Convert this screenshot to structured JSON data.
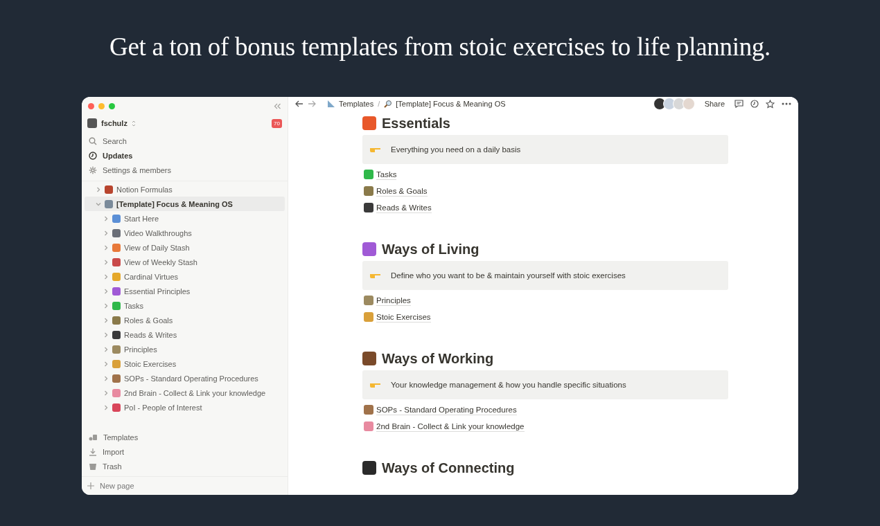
{
  "headline": "Get a ton of bonus templates from stoic exercises to life planning.",
  "sidebar": {
    "workspace": "fschulz",
    "notification_count": "70",
    "nav": [
      {
        "kind": "search",
        "label": "Search",
        "unread": false
      },
      {
        "kind": "updates",
        "label": "Updates",
        "unread": true
      },
      {
        "kind": "settings",
        "label": "Settings & members",
        "unread": false
      }
    ],
    "pages": [
      {
        "label": "Notion Formulas",
        "color": "#b8452e",
        "expanded": false,
        "selected": false
      },
      {
        "label": "[Template] Focus & Meaning OS",
        "color": "#7a8a9a",
        "expanded": true,
        "selected": true,
        "children": [
          {
            "label": "Start Here",
            "color": "#5b8fd6",
            "expanded": false,
            "selected": false
          },
          {
            "label": "Video Walkthroughs",
            "color": "#6b6f78",
            "expanded": false,
            "selected": false
          },
          {
            "label": "View of Daily Stash",
            "color": "#e8793a",
            "expanded": false,
            "selected": false
          },
          {
            "label": "View of Weekly Stash",
            "color": "#c94a4a",
            "expanded": false,
            "selected": false
          },
          {
            "label": "Cardinal Virtues",
            "color": "#e5a82a",
            "expanded": false,
            "selected": false
          },
          {
            "label": "Essential Principles",
            "color": "#a05ad6",
            "expanded": false,
            "selected": false
          },
          {
            "label": "Tasks",
            "color": "#2fb84a",
            "expanded": false,
            "selected": false
          },
          {
            "label": "Roles & Goals",
            "color": "#8a7a4a",
            "expanded": false,
            "selected": false
          },
          {
            "label": "Reads & Writes",
            "color": "#3a3a3a",
            "expanded": false,
            "selected": false
          },
          {
            "label": "Principles",
            "color": "#9c8a60",
            "expanded": false,
            "selected": false
          },
          {
            "label": "Stoic Exercises",
            "color": "#d9a03a",
            "expanded": false,
            "selected": false
          },
          {
            "label": "SOPs - Standard Operating Procedures",
            "color": "#a0724a",
            "expanded": false,
            "selected": false
          },
          {
            "label": "2nd Brain - Collect & Link your knowledge",
            "color": "#e88aa0",
            "expanded": false,
            "selected": false
          },
          {
            "label": "PoI - People of Interest",
            "color": "#d9465a",
            "expanded": false,
            "selected": false
          }
        ]
      }
    ],
    "footer_nav": [
      {
        "kind": "templates",
        "label": "Templates"
      },
      {
        "kind": "import",
        "label": "Import"
      },
      {
        "kind": "trash",
        "label": "Trash"
      }
    ],
    "new_page": "New page"
  },
  "topbar": {
    "breadcrumbs": [
      "Templates",
      "[Template] Focus & Meaning OS"
    ],
    "separator": "/",
    "share": "Share"
  },
  "sections": [
    {
      "title": "Essentials",
      "color": "#e8582a",
      "callout": "Everything you need on a daily basis",
      "links": [
        {
          "label": "Tasks",
          "color": "#2fb84a"
        },
        {
          "label": "Roles & Goals",
          "color": "#8a7a4a"
        },
        {
          "label": "Reads & Writes",
          "color": "#3a3a3a"
        }
      ]
    },
    {
      "title": "Ways of Living",
      "color": "#a05ad6",
      "callout": "Define who you want to be & maintain yourself with stoic exercises",
      "links": [
        {
          "label": "Principles",
          "color": "#9c8a60"
        },
        {
          "label": "Stoic Exercises",
          "color": "#d9a03a"
        }
      ]
    },
    {
      "title": "Ways of Working",
      "color": "#7a4a2a",
      "callout": "Your knowledge management & how you handle specific situations",
      "links": [
        {
          "label": "SOPs - Standard Operating Procedures",
          "color": "#a0724a"
        },
        {
          "label": "2nd Brain - Collect & Link your knowledge",
          "color": "#e88aa0"
        }
      ]
    },
    {
      "title": "Ways of Connecting",
      "color": "#2a2a2a"
    }
  ]
}
